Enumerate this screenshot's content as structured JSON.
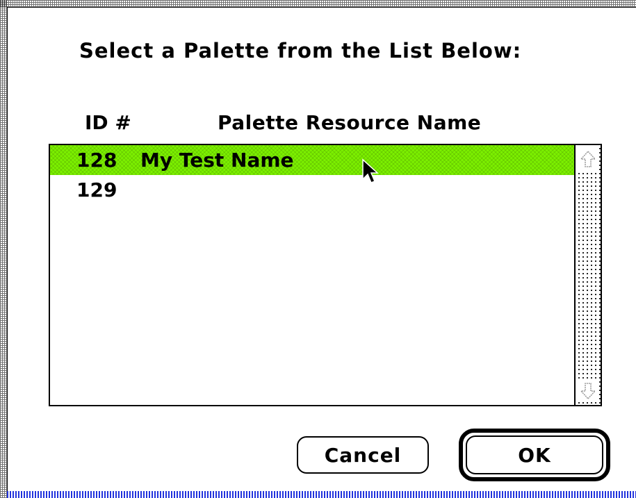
{
  "dialog": {
    "prompt": "Select a Palette from the List Below:",
    "columns": {
      "id_header": "ID #",
      "name_header": "Palette Resource Name"
    },
    "rows": [
      {
        "id": "128",
        "name": "My Test Name",
        "selected": true
      },
      {
        "id": "129",
        "name": "",
        "selected": false
      }
    ],
    "buttons": {
      "cancel_label": "Cancel",
      "ok_label": "OK",
      "default": "OK"
    },
    "colors": {
      "selection": "#7cf000",
      "frame_bottom_stripe": "#2233dd"
    },
    "icons": {
      "scroll_up": "scroll-up-arrow-icon",
      "scroll_down": "scroll-down-arrow-icon",
      "pointer": "mouse-pointer-icon"
    }
  }
}
